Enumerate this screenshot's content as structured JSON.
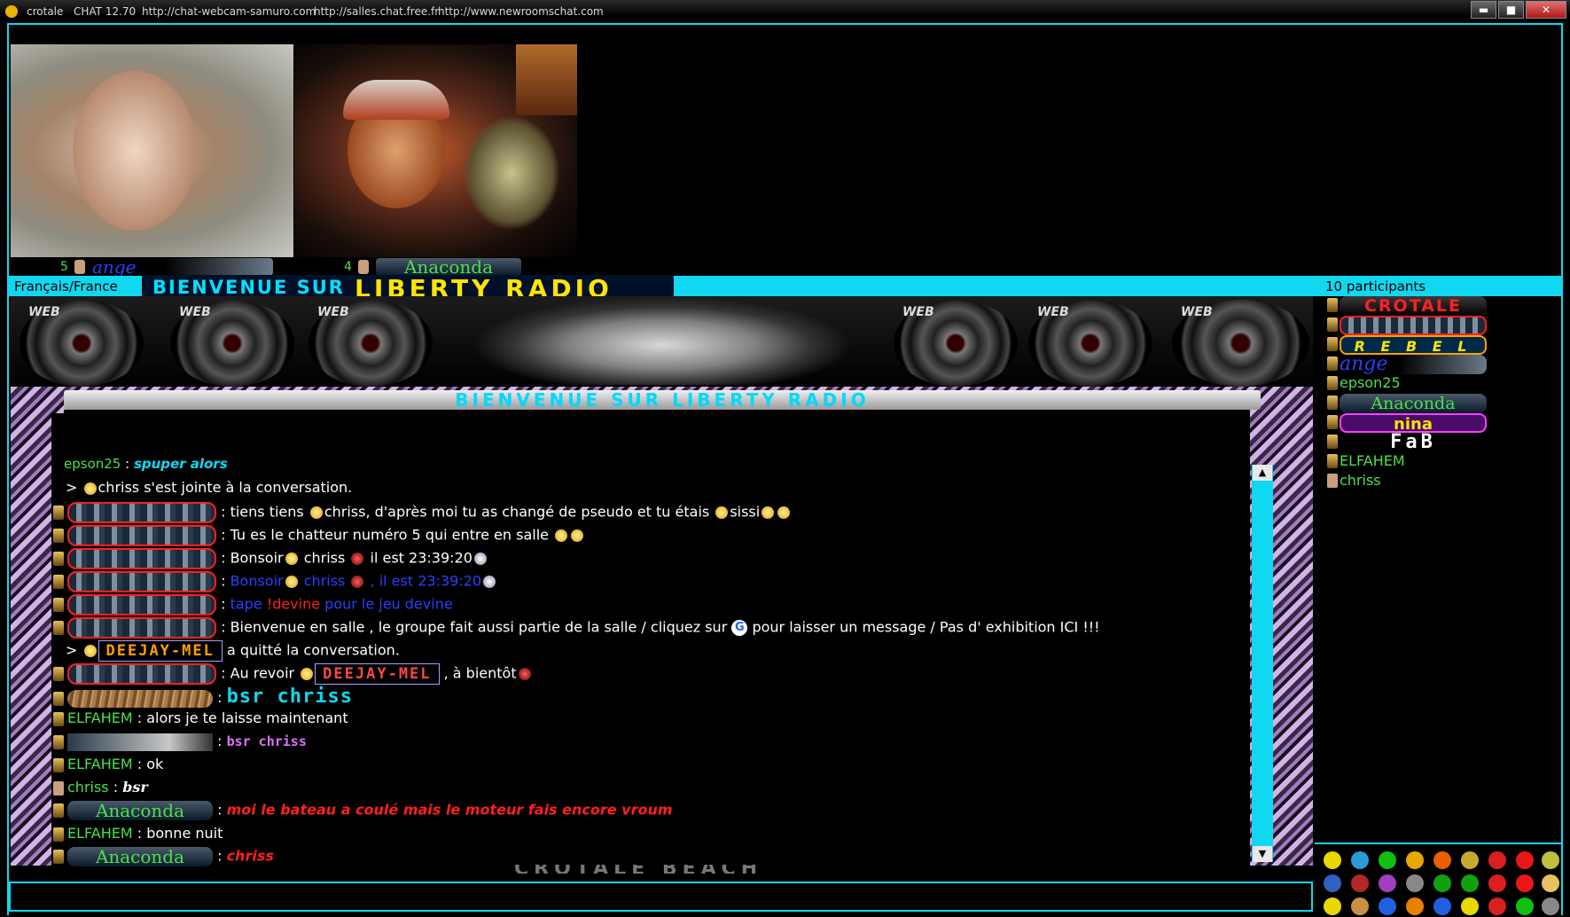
{
  "titlebar": {
    "app": "crotale",
    "version": "CHAT 12.70",
    "link1": "http://chat-webcam-samuro.com",
    "link2": "http://salles.chat.free.fr",
    "link3": "http://www.newroomschat.com",
    "minimize": "▬",
    "maximize": "■",
    "close": "✕"
  },
  "cams": [
    {
      "number": "5",
      "nick": "ange"
    },
    {
      "number": "4",
      "nick": "Anaconda"
    }
  ],
  "topbar": {
    "language": "Français/France",
    "participants": "10 participants",
    "banner_left": "BIENVENUE SUR",
    "banner_right": "LIBERTY  RADIO"
  },
  "room": {
    "speaker_label": "WEB",
    "chat_title": "BIENVENUE SUR LIBERTY RADIO",
    "footer_ghost": "CROTALE BEACH"
  },
  "messages": {
    "m0": {
      "nick": "epson25",
      "text": "spuper alors"
    },
    "m1": {
      "text": "chriss s'est jointe à la conversation."
    },
    "m2": {
      "text_a": "tiens tiens ",
      "text_b": "chriss, d'après moi tu as changé de pseudo et tu étais ",
      "text_c": "sissi"
    },
    "m3": {
      "text": "Tu es le chatteur numéro 5 qui entre en salle"
    },
    "m4": {
      "a": "Bonsoir",
      "b": " chriss ",
      "c": " il est 23:39:20"
    },
    "m5": {
      "a": "Bonsoir",
      "b": " chriss ",
      "c": " , il est 23:39:20"
    },
    "m6": {
      "a": "tape ",
      "b": "!devine",
      "c": " pour le jeu devine"
    },
    "m7": {
      "a": "Bienvenue en salle ,  le groupe fait aussi partie de la salle  /  cliquez sur ",
      "badge": "G",
      "b": " pour laisser un message / Pas d' exhibition ICI !!!"
    },
    "m8": {
      "dj": "DEEJAY-MEL",
      "text": "a quitté la conversation."
    },
    "m9": {
      "a": "Au revoir ",
      "dj": "DEEJAY-MEL",
      "b": " , à bientôt"
    },
    "m10": {
      "text": "bsr chriss"
    },
    "m11": {
      "nick": "ELFAHEM",
      "text": "alors je te laisse maintenant"
    },
    "m12": {
      "text": "bsr chriss"
    },
    "m13": {
      "nick": "ELFAHEM",
      "text": "ok"
    },
    "m14": {
      "nick": "chriss",
      "text": "bsr"
    },
    "m15": {
      "nick": "Anaconda",
      "text": "moi le bateau a coulé mais le moteur fais encore vroum"
    },
    "m16": {
      "nick": "ELFAHEM",
      "text": "bonne nuit"
    },
    "m17": {
      "nick": "Anaconda",
      "text": "chriss"
    },
    "separator": " : ",
    "prompt": ">"
  },
  "users": [
    {
      "name": "CROTALE",
      "color": "#ff2020"
    },
    {
      "name": "",
      "color": "#ff2020"
    },
    {
      "name": "R E B E L",
      "color": "#ffe400"
    },
    {
      "name": "ange",
      "color": "#2840ff"
    },
    {
      "name": "epson25",
      "color": "#4ce04c"
    },
    {
      "name": "Anaconda",
      "color": "#4ce04c"
    },
    {
      "name": "nina",
      "color": "#ffe400"
    },
    {
      "name": "FaB",
      "color": "#ffffff"
    },
    {
      "name": "ELFAHEM",
      "color": "#4ce04c"
    },
    {
      "name": "chriss",
      "color": "#4ce04c"
    }
  ],
  "scroll": {
    "up": "▲",
    "down": "▼"
  },
  "input": {
    "value": ""
  },
  "colors": {
    "accent": "#10d8f0",
    "nick_green": "#4ce04c",
    "red": "#ff2020",
    "blue": "#2840ff"
  }
}
